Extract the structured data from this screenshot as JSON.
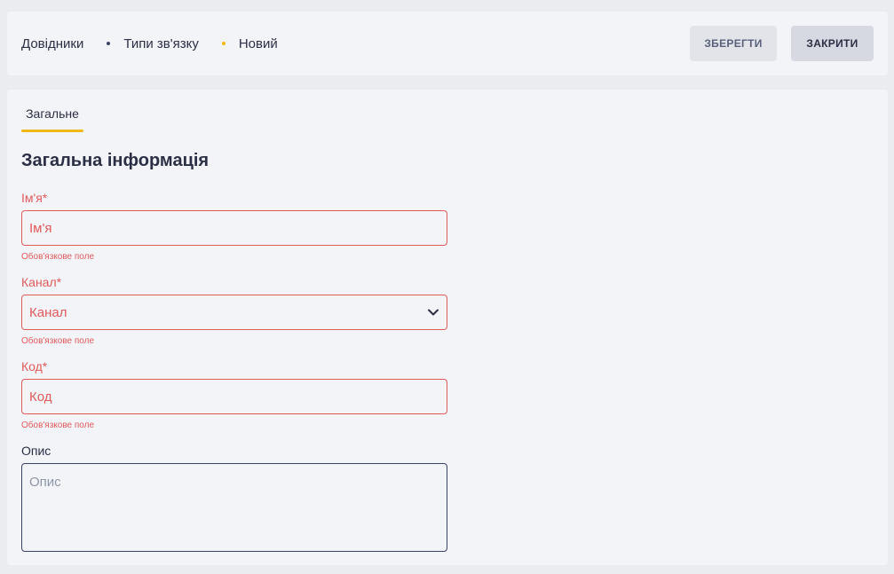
{
  "header": {
    "breadcrumb": [
      "Довідники",
      "Типи зв'язку",
      "Новий"
    ],
    "save_label": "ЗБЕРЕГТИ",
    "close_label": "ЗАКРИТИ"
  },
  "tabs": [
    {
      "label": "Загальне",
      "active": true
    }
  ],
  "section_title": "Загальна інформація",
  "fields": {
    "name": {
      "label": "Ім'я*",
      "placeholder": "Ім'я",
      "error": "Обов'язкове поле"
    },
    "channel": {
      "label": "Канал*",
      "placeholder": "Канал",
      "error": "Обов'язкове поле"
    },
    "code": {
      "label": "Код*",
      "placeholder": "Код",
      "error": "Обов'язкове поле"
    },
    "description": {
      "label": "Опис",
      "placeholder": "Опис"
    }
  },
  "colors": {
    "accent": "#f2b817",
    "error": "#e05a5a",
    "text": "#2b2f45"
  },
  "icons": {
    "select_arrow": "chevron-down-icon"
  }
}
